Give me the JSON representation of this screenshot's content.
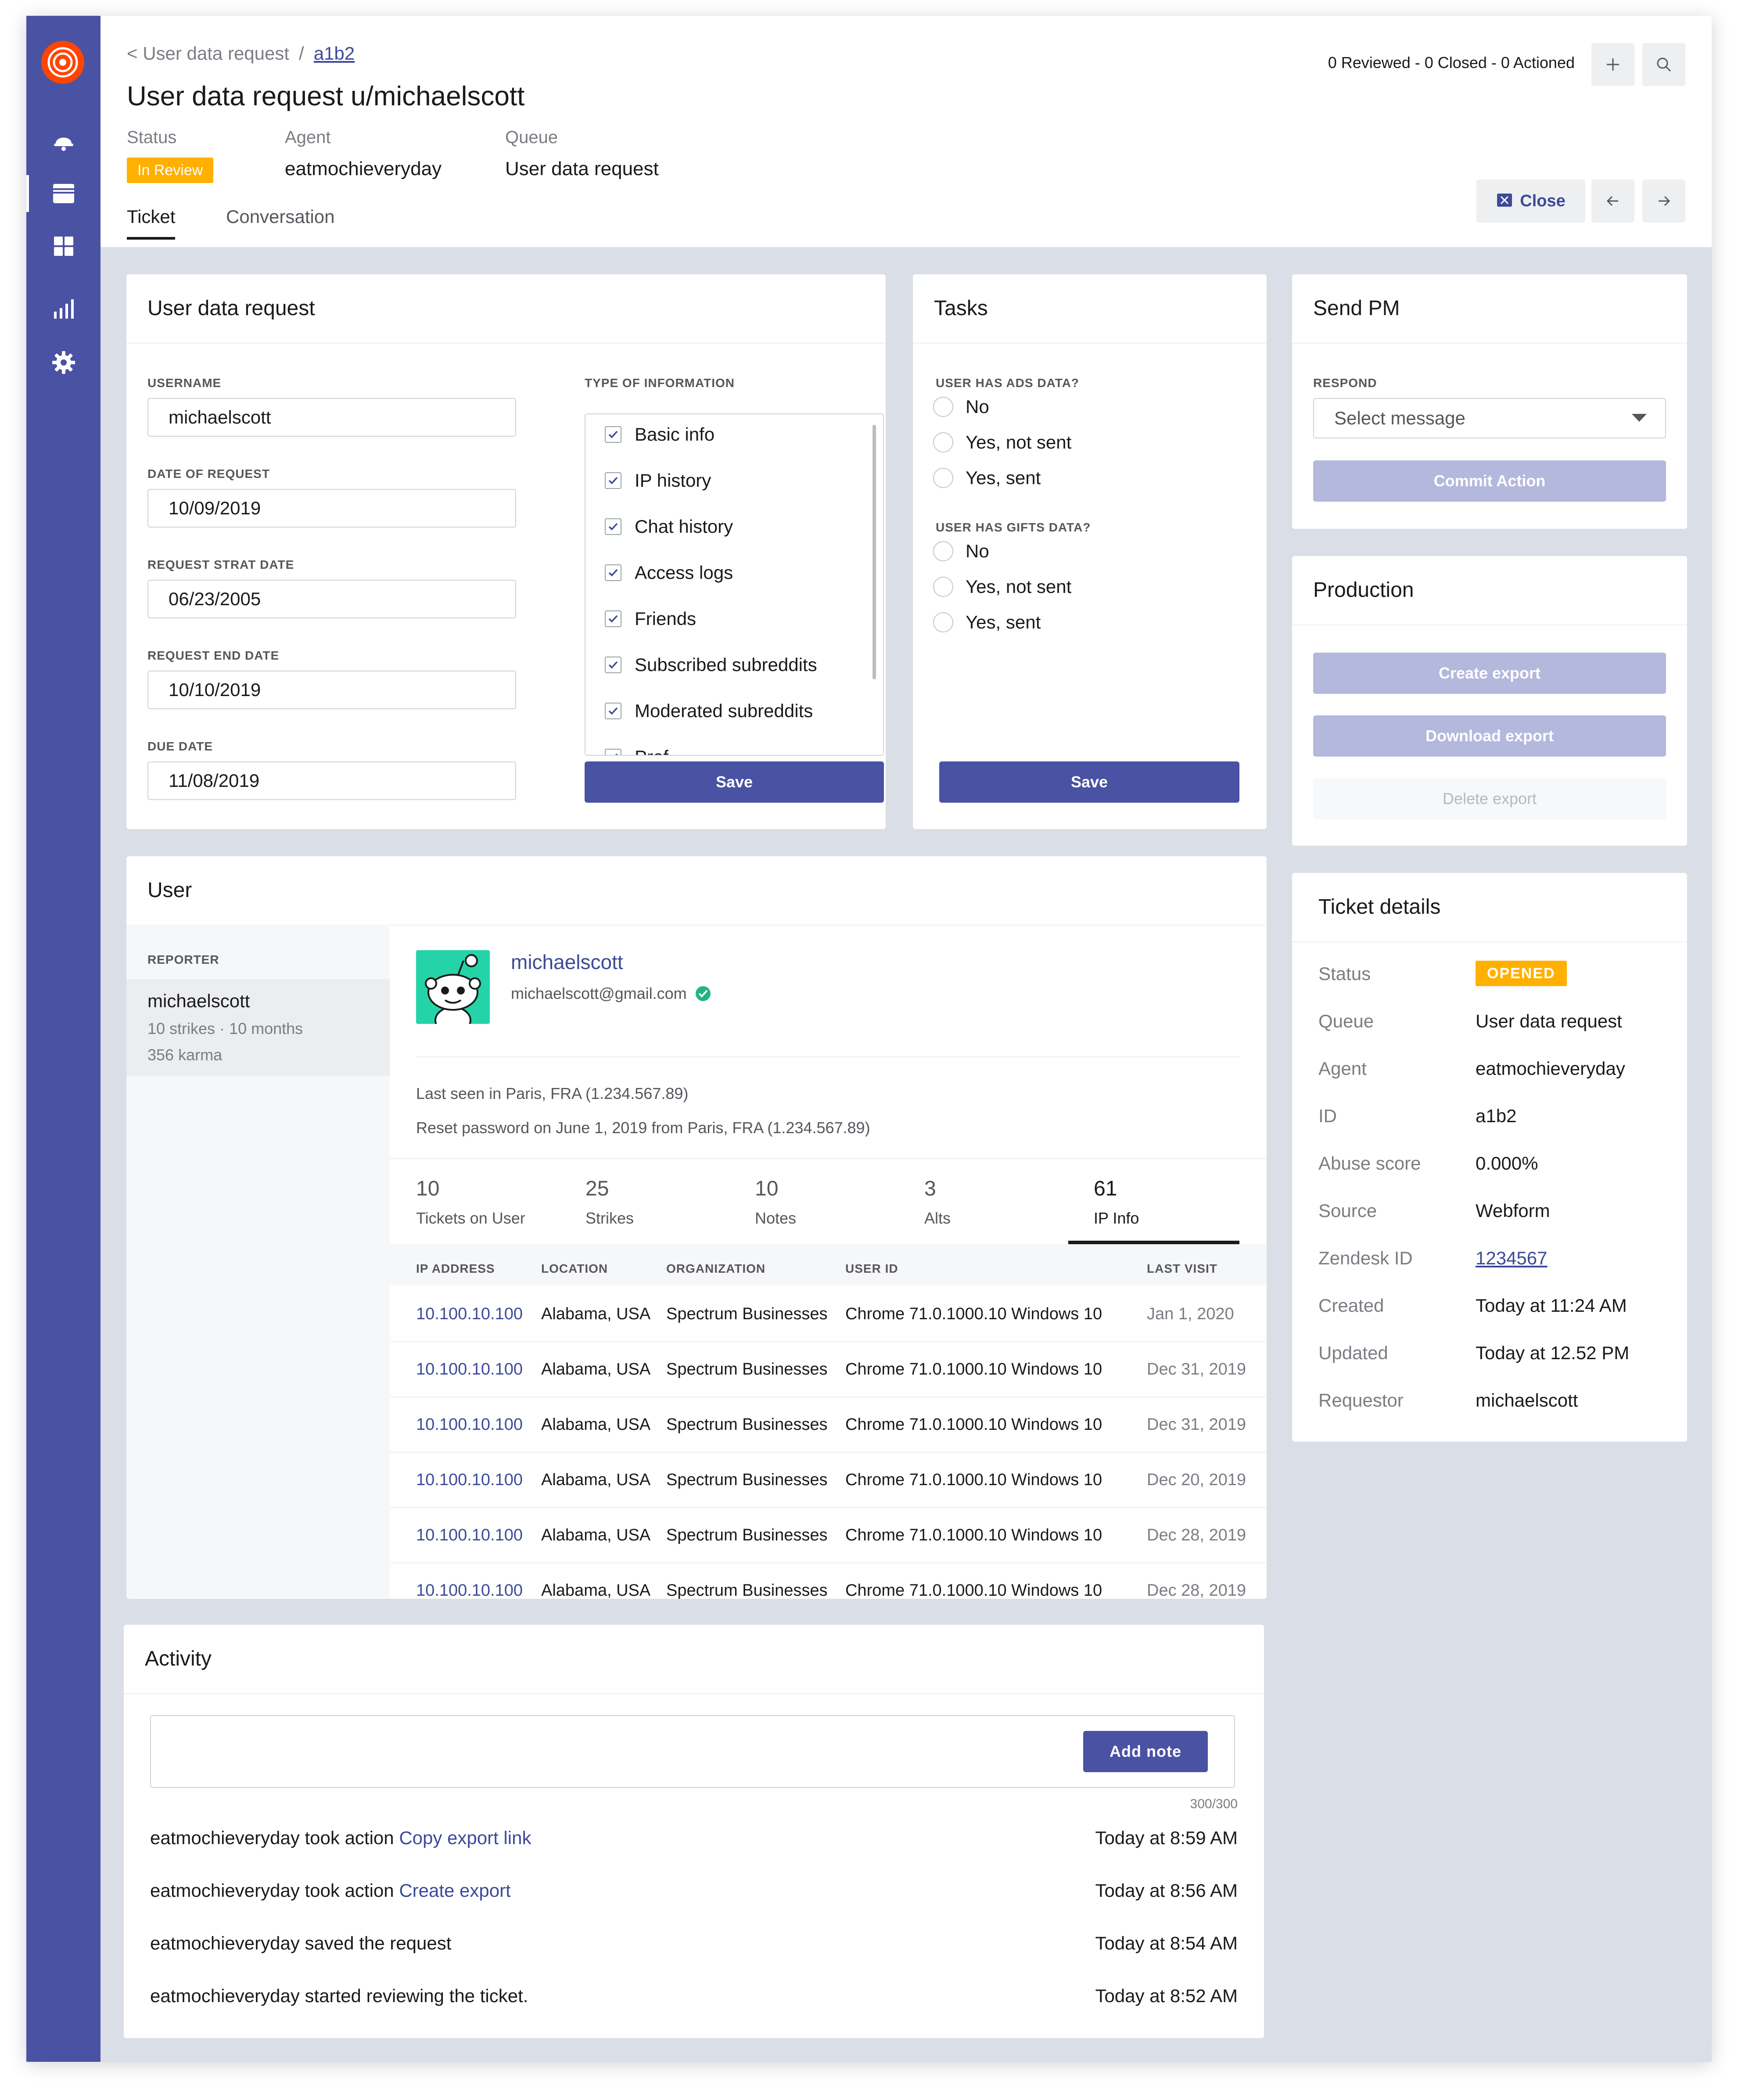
{
  "header": {
    "breadcrumb_back": "< User data request",
    "breadcrumb_sep": "/",
    "breadcrumb_id": "a1b2",
    "title": "User data request u/michaelscott",
    "counts": "0 Reviewed - 0 Closed - 0 Actioned",
    "status_label": "Status",
    "status_value": "In Review",
    "agent_label": "Agent",
    "agent_value": "eatmochieveryday",
    "queue_label": "Queue",
    "queue_value": "User data request",
    "tab_ticket": "Ticket",
    "tab_conversation": "Conversation",
    "close_label": "Close"
  },
  "sidebar": {
    "icons": [
      "notification-icon",
      "tickets-icon",
      "grid-icon",
      "stats-icon",
      "settings-icon"
    ]
  },
  "request_card": {
    "title": "User data request",
    "username_label": "USERNAME",
    "username_value": "michaelscott",
    "date_label": "DATE OF REQUEST",
    "date_value": "10/09/2019",
    "start_label": "REQUEST STRAT DATE",
    "start_value": "06/23/2005",
    "end_label": "REQUEST END DATE",
    "end_value": "10/10/2019",
    "due_label": "DUE DATE",
    "due_value": "11/08/2019",
    "info_label": "TYPE OF INFORMATION",
    "info_items": [
      "Basic info",
      "IP history",
      "Chat history",
      "Access logs",
      "Friends",
      "Subscribed subreddits",
      "Moderated subreddits",
      "Prof..."
    ],
    "save_label": "Save"
  },
  "tasks_card": {
    "title": "Tasks",
    "ads_label": "USER HAS ADS DATA?",
    "ads_options": [
      "No",
      "Yes, not sent",
      "Yes, sent"
    ],
    "gifts_label": "USER HAS GIFTS DATA?",
    "gifts_options": [
      "No",
      "Yes, not sent",
      "Yes, sent"
    ],
    "save_label": "Save"
  },
  "pm_card": {
    "title": "Send PM",
    "respond_label": "RESPOND",
    "select_placeholder": "Select message",
    "commit_label": "Commit Action"
  },
  "production_card": {
    "title": "Production",
    "create_label": "Create export",
    "download_label": "Download export",
    "delete_label": "Delete export"
  },
  "details_card": {
    "title": "Ticket details",
    "rows": [
      {
        "label": "Status",
        "value": "OPENED"
      },
      {
        "label": "Queue",
        "value": "User data request"
      },
      {
        "label": "Agent",
        "value": "eatmochieveryday"
      },
      {
        "label": "ID",
        "value": "a1b2"
      },
      {
        "label": "Abuse score",
        "value": "0.000%"
      },
      {
        "label": "Source",
        "value": "Webform"
      },
      {
        "label": "Zendesk ID",
        "value": "1234567"
      },
      {
        "label": "Created",
        "value": "Today at 11:24 AM"
      },
      {
        "label": "Updated",
        "value": "Today at 12.52 PM"
      },
      {
        "label": "Requestor",
        "value": "michaelscott"
      }
    ]
  },
  "user_card": {
    "title": "User",
    "reporter_label": "REPORTER",
    "reporter_name": "michaelscott",
    "reporter_meta1": "10 strikes · 10 months",
    "reporter_meta2": "356 karma",
    "username": "michaelscott",
    "email": "michaelscott@gmail.com",
    "last_seen": "Last seen in Paris, FRA (1.234.567.89)",
    "reset": "Reset password on June 1, 2019 from Paris, FRA (1.234.567.89)",
    "stats": [
      {
        "num": "10",
        "label": "Tickets on User"
      },
      {
        "num": "25",
        "label": "Strikes"
      },
      {
        "num": "10",
        "label": "Notes"
      },
      {
        "num": "3",
        "label": "Alts"
      },
      {
        "num": "61",
        "label": "IP Info"
      }
    ],
    "table_headers": [
      "IP ADDRESS",
      "LOCATION",
      "ORGANIZATION",
      "USER ID",
      "LAST VISIT"
    ],
    "table_rows": [
      [
        "10.100.10.100",
        "Alabama, USA",
        "Spectrum Businesses",
        "Chrome 71.0.1000.10 Windows 10",
        "Jan 1, 2020"
      ],
      [
        "10.100.10.100",
        "Alabama, USA",
        "Spectrum Businesses",
        "Chrome 71.0.1000.10 Windows 10",
        "Dec 31, 2019"
      ],
      [
        "10.100.10.100",
        "Alabama, USA",
        "Spectrum Businesses",
        "Chrome 71.0.1000.10 Windows 10",
        "Dec 31, 2019"
      ],
      [
        "10.100.10.100",
        "Alabama, USA",
        "Spectrum Businesses",
        "Chrome 71.0.1000.10 Windows 10",
        "Dec 20, 2019"
      ],
      [
        "10.100.10.100",
        "Alabama, USA",
        "Spectrum Businesses",
        "Chrome 71.0.1000.10 Windows 10",
        "Dec 28, 2019"
      ],
      [
        "10.100.10.100",
        "Alabama, USA",
        "Spectrum Businesses",
        "Chrome 71.0.1000.10 Windows 10",
        "Dec 28, 2019"
      ]
    ]
  },
  "activity_card": {
    "title": "Activity",
    "add_note_label": "Add note",
    "char_count": "300/300",
    "items": [
      {
        "text": "eatmochieveryday took action ",
        "link": "Copy export link",
        "time": "Today at 8:59 AM"
      },
      {
        "text": "eatmochieveryday took action ",
        "link": "Create export",
        "time": "Today at 8:56 AM"
      },
      {
        "text": "eatmochieveryday saved the request",
        "link": "",
        "time": "Today at 8:54 AM"
      },
      {
        "text": "eatmochieveryday started reviewing the ticket.",
        "link": "",
        "time": "Today at 8:52 AM"
      }
    ]
  },
  "colors": {
    "sidebar": "#4a52a3",
    "accent": "#3d4a99",
    "status": "#ffb000",
    "logo": "#ff4500",
    "avatar_bg": "#24d4a8"
  }
}
